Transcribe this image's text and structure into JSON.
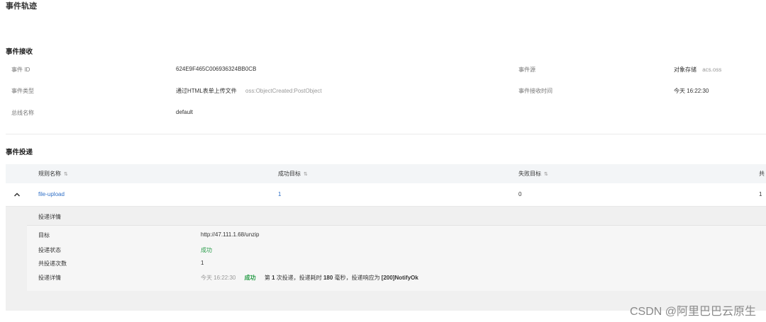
{
  "page_title": "事件轨迹",
  "receive": {
    "title": "事件接收",
    "event_id_label": "事件 ID",
    "event_id": "624E9F465C006936324BB0CB",
    "source_label": "事件源",
    "source_name": "对象存储",
    "source_code": "acs.oss",
    "type_label": "事件类型",
    "type_name": "通过HTML表单上传文件",
    "type_code": "oss:ObjectCreated:PostObject",
    "time_label": "事件接收时间",
    "time_value": "今天 16:22:30",
    "bus_label": "总线名称",
    "bus_value": "default"
  },
  "delivery": {
    "title": "事件投递",
    "columns": {
      "rule": "规则名称",
      "success": "成功目标",
      "failed": "失败目标",
      "total": "共"
    },
    "row": {
      "rule": "file-upload",
      "success": "1",
      "failed": "0",
      "total": "1"
    },
    "detail": {
      "header": "投递详情",
      "target_label": "目标",
      "target_value": "http://47.111.1.68/unzip",
      "status_label": "投递状态",
      "status_value": "成功",
      "count_label": "共投递次数",
      "count_value": "1",
      "detail_label": "投递详情",
      "detail_time": "今天 16:22:30",
      "detail_status": "成功",
      "detail_msg_a": "第 ",
      "detail_msg_b": "1",
      "detail_msg_c": " 次投递，投递耗时 ",
      "detail_msg_d": "180",
      "detail_msg_e": " 毫秒，投递响应为 ",
      "detail_msg_f": "[200]NotifyOk"
    }
  },
  "watermark": "CSDN @阿里巴巴云原生",
  "colors": {
    "link": "#2f6fc7",
    "success": "#2a9d4a",
    "header_bg": "#f3f5f7"
  }
}
